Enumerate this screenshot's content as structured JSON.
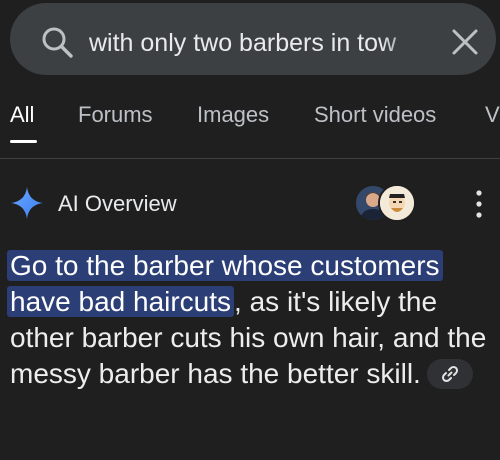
{
  "search": {
    "query": "with only two barbers in tow",
    "icon": "search-icon",
    "clear_icon": "close-icon"
  },
  "tabs": [
    {
      "label": "All",
      "active": true
    },
    {
      "label": "Forums",
      "active": false
    },
    {
      "label": "Images",
      "active": false
    },
    {
      "label": "Short videos",
      "active": false
    },
    {
      "label": "V",
      "active": false
    }
  ],
  "ai_overview": {
    "icon": "sparkle-icon",
    "title": "AI Overview",
    "avatars": [
      "avatar-person",
      "avatar-cartoon"
    ],
    "answer": {
      "highlight_1": "Go to the barber whose customers",
      "highlight_2": "have bad haircuts",
      "rest": ", as it's likely the other barber cuts his own hair, and the messy barber has the better skill.",
      "link_icon": "link-icon"
    }
  },
  "colors": {
    "background": "#1f1f1f",
    "search_bar": "#3c4043",
    "highlight": "#2c3e76",
    "sparkle": "#4f8ef7"
  }
}
